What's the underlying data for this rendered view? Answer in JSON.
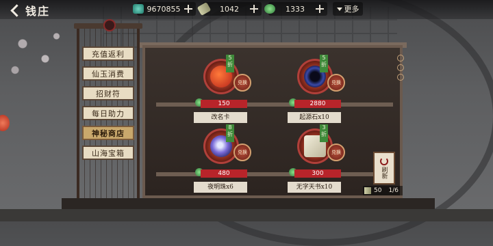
{
  "header": {
    "back_label": "钱庄"
  },
  "currencies": [
    {
      "icon": "jade-icon",
      "value": "9670855"
    },
    {
      "icon": "scroll-icon",
      "value": "1042"
    },
    {
      "icon": "coin-icon",
      "value": "1333"
    }
  ],
  "more": {
    "label": "更多"
  },
  "menu": {
    "items": [
      {
        "label": "充值返利"
      },
      {
        "label": "仙玉消费"
      },
      {
        "label": "招财符"
      },
      {
        "label": "每日助力"
      },
      {
        "label": "神秘商店",
        "active": true
      },
      {
        "label": "山海宝箱"
      }
    ]
  },
  "shop": {
    "items": [
      {
        "name": "改名卡",
        "price": "150",
        "discount": "5折",
        "buy": "兑换",
        "icon": "rename-card-icon"
      },
      {
        "name": "起源石x10",
        "price": "2880",
        "discount": "5折",
        "buy": "兑换",
        "icon": "origin-stone-icon"
      },
      {
        "name": "夜明珠x6",
        "price": "480",
        "discount": "8折",
        "buy": "兑换",
        "icon": "night-pearl-icon"
      },
      {
        "name": "无字天书x10",
        "price": "300",
        "discount": "3折",
        "buy": "兑换",
        "icon": "blank-scroll-icon"
      }
    ]
  },
  "refresh": {
    "label": "刷新",
    "cost": "50",
    "count": "1/6"
  }
}
